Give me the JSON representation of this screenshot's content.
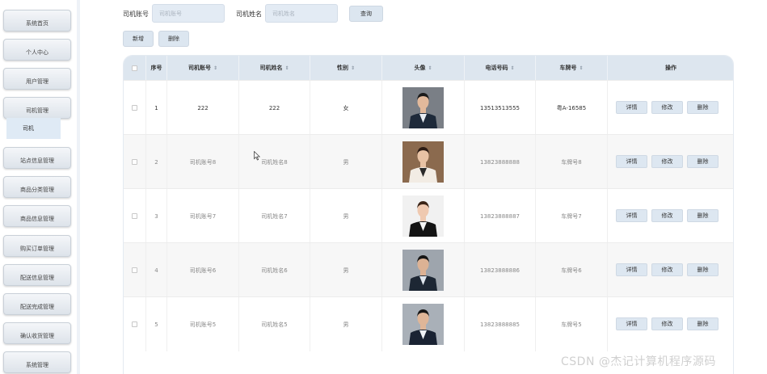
{
  "sidebar": {
    "items": [
      {
        "label": "系统首页"
      },
      {
        "label": "个人中心"
      },
      {
        "label": "用户管理"
      },
      {
        "label": "司机管理"
      },
      {
        "label": "站点信息管理"
      },
      {
        "label": "商品分类管理"
      },
      {
        "label": "商品信息管理"
      },
      {
        "label": "购买订单管理"
      },
      {
        "label": "配送信息管理"
      },
      {
        "label": "配送完成管理"
      },
      {
        "label": "确认收货管理"
      },
      {
        "label": "系统管理"
      }
    ],
    "submenu": "司机"
  },
  "search": {
    "account_label": "司机账号",
    "account_placeholder": "司机账号",
    "name_label": "司机姓名",
    "name_placeholder": "司机姓名",
    "query_button": "查询"
  },
  "toolbar": {
    "add_button": "新增",
    "delete_button": "删除"
  },
  "table": {
    "headers": {
      "index": "序号",
      "account": "司机账号",
      "name": "司机姓名",
      "gender": "性别",
      "avatar": "头像",
      "phone": "电话号码",
      "plate": "车牌号",
      "actions": "操作"
    },
    "action_labels": {
      "detail": "详情",
      "edit": "修改",
      "delete": "删除"
    },
    "rows": [
      {
        "index": "1",
        "account": "222",
        "name": "222",
        "gender": "女",
        "phone": "13513513555",
        "plate": "粤A-16585"
      },
      {
        "index": "2",
        "account": "司机账号8",
        "name": "司机姓名8",
        "gender": "男",
        "phone": "13823888888",
        "plate": "车牌号8"
      },
      {
        "index": "3",
        "account": "司机账号7",
        "name": "司机姓名7",
        "gender": "男",
        "phone": "13823888887",
        "plate": "车牌号7"
      },
      {
        "index": "4",
        "account": "司机账号6",
        "name": "司机姓名6",
        "gender": "男",
        "phone": "13823888886",
        "plate": "车牌号6"
      },
      {
        "index": "5",
        "account": "司机账号5",
        "name": "司机姓名5",
        "gender": "男",
        "phone": "13823888885",
        "plate": "车牌号5"
      }
    ]
  },
  "watermark": "CSDN @杰记计算机程序源码",
  "colors": {
    "header_bg": "#dde6ef",
    "button_bg": "#dce6f0",
    "input_bg": "#e3ebf4",
    "submenu_bg": "#dfeaf5"
  }
}
